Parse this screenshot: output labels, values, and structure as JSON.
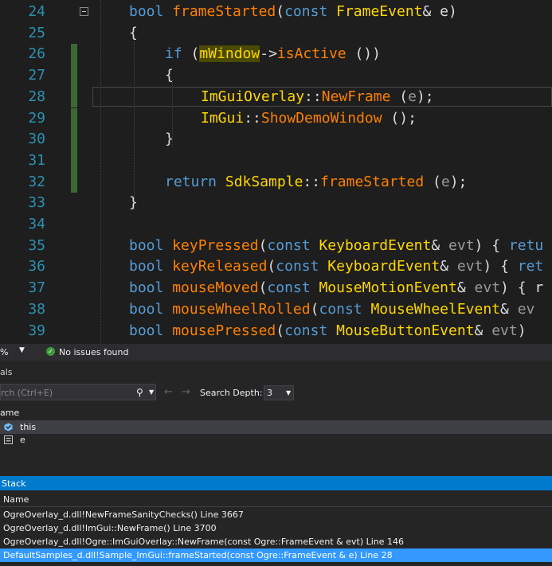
{
  "editor": {
    "lines": [
      {
        "num": "24",
        "tokens": [
          [
            "kw",
            "bool"
          ],
          [
            "",
            "·"
          ],
          [
            "fn",
            "frameStarted"
          ],
          [
            "",
            "("
          ],
          [
            "kw",
            "const"
          ],
          [
            "",
            ""
          ],
          [
            "ty",
            "·FrameEvent"
          ],
          [
            "",
            "&·e)"
          ]
        ]
      },
      {
        "num": "25",
        "tokens": [
          [
            "",
            "{"
          ]
        ]
      },
      {
        "num": "26",
        "tokens": [
          [
            "kw",
            "if"
          ],
          [
            "",
            "·("
          ],
          [
            "hl",
            "mWindow"
          ],
          [
            "",
            "->"
          ],
          [
            "fn",
            "isActive"
          ],
          [
            "",
            "·())"
          ]
        ]
      },
      {
        "num": "27",
        "tokens": [
          [
            "",
            "{"
          ]
        ]
      },
      {
        "num": "28",
        "tokens": [
          [
            "ty",
            "ImGuiOverlay"
          ],
          [
            "",
            "::"
          ],
          [
            "fn",
            "NewFrame"
          ],
          [
            "",
            "·("
          ],
          [
            "pm",
            "e"
          ],
          [
            "",
            ");"
          ]
        ]
      },
      {
        "num": "29",
        "tokens": [
          [
            "ty",
            "ImGui"
          ],
          [
            "",
            "::"
          ],
          [
            "fn",
            "ShowDemoWindow"
          ],
          [
            "",
            "·();"
          ]
        ]
      },
      {
        "num": "30",
        "tokens": [
          [
            "",
            "}"
          ]
        ]
      },
      {
        "num": "31",
        "tokens": []
      },
      {
        "num": "32",
        "tokens": [
          [
            "kw",
            "return"
          ],
          [
            "",
            "·"
          ],
          [
            "ty",
            "SdkSample"
          ],
          [
            "",
            "::"
          ],
          [
            "fn",
            "frameStarted"
          ],
          [
            "",
            "·("
          ],
          [
            "pm",
            "e"
          ],
          [
            "",
            ");"
          ]
        ]
      },
      {
        "num": "33",
        "tokens": [
          [
            "",
            "}"
          ]
        ]
      },
      {
        "num": "34",
        "tokens": []
      },
      {
        "num": "35",
        "tokens": [
          [
            "kw",
            "bool"
          ],
          [
            "",
            "·"
          ],
          [
            "fn",
            "keyPressed"
          ],
          [
            "",
            "("
          ],
          [
            "kw",
            "const"
          ],
          [
            "",
            "·"
          ],
          [
            "ty",
            "KeyboardEvent"
          ],
          [
            "",
            "&·"
          ],
          [
            "pm",
            "evt"
          ],
          [
            "",
            ")·{·"
          ],
          [
            "kw",
            "retu"
          ]
        ]
      },
      {
        "num": "36",
        "tokens": [
          [
            "kw",
            "bool"
          ],
          [
            "",
            "·"
          ],
          [
            "fn",
            "keyReleased"
          ],
          [
            "",
            "("
          ],
          [
            "kw",
            "const"
          ],
          [
            "",
            "·"
          ],
          [
            "ty",
            "KeyboardEvent"
          ],
          [
            "",
            "&·"
          ],
          [
            "pm",
            "evt"
          ],
          [
            "",
            ")·{·"
          ],
          [
            "kw",
            "ret"
          ]
        ]
      },
      {
        "num": "37",
        "tokens": [
          [
            "kw",
            "bool"
          ],
          [
            "",
            "·"
          ],
          [
            "fn",
            "mouseMoved"
          ],
          [
            "",
            "("
          ],
          [
            "kw",
            "const"
          ],
          [
            "",
            "·"
          ],
          [
            "ty",
            "MouseMotionEvent"
          ],
          [
            "",
            "&·"
          ],
          [
            "pm",
            "evt"
          ],
          [
            "",
            ")·{·r"
          ]
        ]
      },
      {
        "num": "38",
        "tokens": [
          [
            "kw",
            "bool"
          ],
          [
            "",
            "·"
          ],
          [
            "fn",
            "mouseWheelRolled"
          ],
          [
            "",
            "("
          ],
          [
            "kw",
            "const"
          ],
          [
            "",
            "·"
          ],
          [
            "ty",
            "MouseWheelEvent"
          ],
          [
            "",
            "&·"
          ],
          [
            "pm",
            "ev"
          ]
        ]
      },
      {
        "num": "39",
        "tokens": [
          [
            "kw",
            "bool"
          ],
          [
            "",
            "·"
          ],
          [
            "fn",
            "mousePressed"
          ],
          [
            "",
            "("
          ],
          [
            "kw",
            "const"
          ],
          [
            "",
            "·"
          ],
          [
            "ty",
            "MouseButtonEvent"
          ],
          [
            "",
            "&·"
          ],
          [
            "pm",
            "evt"
          ],
          [
            "",
            ")·"
          ]
        ]
      }
    ]
  },
  "statusbar": {
    "zoom": "%",
    "issues": "No issues found"
  },
  "locals": {
    "title": "als",
    "search_placeholder": "rch (Ctrl+E)",
    "search_depth_label": "Search Depth:",
    "search_depth_value": "3",
    "column_name": "ame",
    "rows": [
      {
        "name": "this",
        "icon": "object-icon"
      },
      {
        "name": "e",
        "icon": "parameter-icon"
      }
    ]
  },
  "callstack": {
    "title": "Stack",
    "column_name": "Name",
    "rows": [
      "OgreOverlay_d.dll!NewFrameSanityChecks() Line 3667",
      "OgreOverlay_d.dll!ImGui::NewFrame() Line 3700",
      "OgreOverlay_d.dll!Ogre::ImGuiOverlay::NewFrame(const Ogre::FrameEvent & evt) Line 146",
      "DefaultSamples_d.dll!Sample_ImGui::frameStarted(const Ogre::FrameEvent & e) Line 28"
    ]
  },
  "colors": {
    "keyword": "#569cd6",
    "function": "#ff8000",
    "type": "#ffd700",
    "selection": "#3399ff",
    "titlebar": "#007acc"
  }
}
